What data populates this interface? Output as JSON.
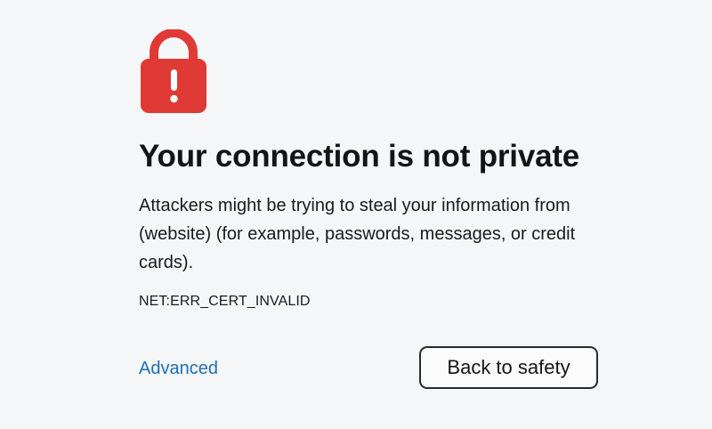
{
  "icon": {
    "name": "lock-warning-icon",
    "color": "#df3a35",
    "glyph_color": "#ffffff"
  },
  "interstitial": {
    "title": "Your connection is not private",
    "description": "Attackers might be trying to steal your information from (website) (for example, passwords, messages, or credit cards).",
    "error_code": "NET:ERR_CERT_INVALID",
    "advanced_label": "Advanced",
    "back_button_label": "Back to safety"
  },
  "colors": {
    "background": "#f5f6f8",
    "link": "#1c6fb5",
    "lock": "#df3a35"
  }
}
